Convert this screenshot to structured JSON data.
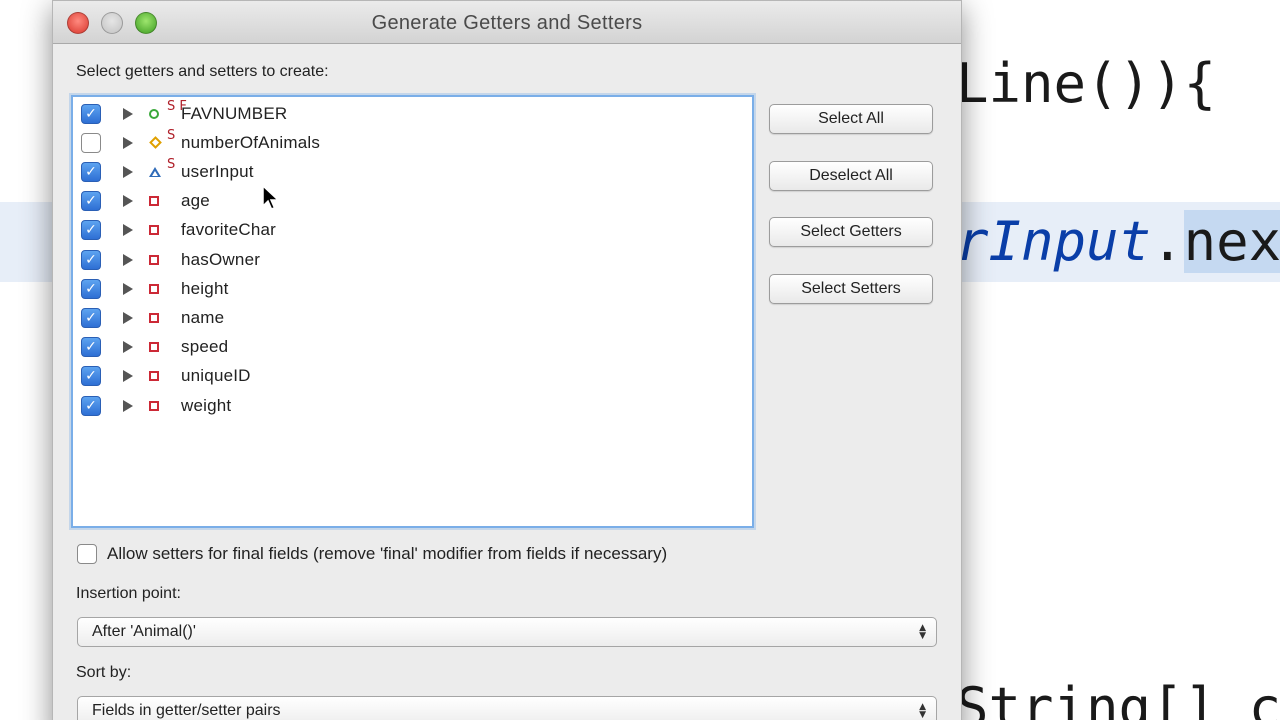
{
  "editor": {
    "line1": "Line()){",
    "line2_italic": "rInput",
    "line2_dot": ".",
    "line2_sel": "nex",
    "line3": "String[] c"
  },
  "dialog": {
    "title": "Generate Getters and Setters",
    "prompt": "Select getters and setters to create:",
    "fields": [
      {
        "name": "FAVNUMBER",
        "checked": true,
        "icon": "constant-field-icon",
        "modifier": "S F"
      },
      {
        "name": "numberOfAnimals",
        "checked": false,
        "icon": "default-field-icon",
        "modifier": "S"
      },
      {
        "name": "userInput",
        "checked": true,
        "icon": "protected-field-icon",
        "modifier": "S"
      },
      {
        "name": "age",
        "checked": true,
        "icon": "private-field-icon",
        "modifier": ""
      },
      {
        "name": "favoriteChar",
        "checked": true,
        "icon": "private-field-icon",
        "modifier": ""
      },
      {
        "name": "hasOwner",
        "checked": true,
        "icon": "private-field-icon",
        "modifier": ""
      },
      {
        "name": "height",
        "checked": true,
        "icon": "private-field-icon",
        "modifier": ""
      },
      {
        "name": "name",
        "checked": true,
        "icon": "private-field-icon",
        "modifier": ""
      },
      {
        "name": "speed",
        "checked": true,
        "icon": "private-field-icon",
        "modifier": ""
      },
      {
        "name": "uniqueID",
        "checked": true,
        "icon": "private-field-icon",
        "modifier": ""
      },
      {
        "name": "weight",
        "checked": true,
        "icon": "private-field-icon",
        "modifier": ""
      }
    ],
    "buttons": {
      "select_all": "Select All",
      "deselect_all": "Deselect All",
      "select_getters": "Select Getters",
      "select_setters": "Select Setters"
    },
    "allow_setters_label": "Allow setters for final fields (remove 'final' modifier from fields if necessary)",
    "allow_setters_checked": false,
    "insertion_label": "Insertion point:",
    "insertion_value": "After 'Animal()'",
    "sort_label": "Sort by:",
    "sort_value": "Fields in getter/setter pairs"
  },
  "colors": {
    "accent": "#7aaee8",
    "checkbox": "#2e6fd4",
    "private_icon": "#cc2936",
    "constant_icon": "#3aa83a",
    "default_icon": "#e0a000",
    "protected_icon": "#2f6bb8"
  }
}
